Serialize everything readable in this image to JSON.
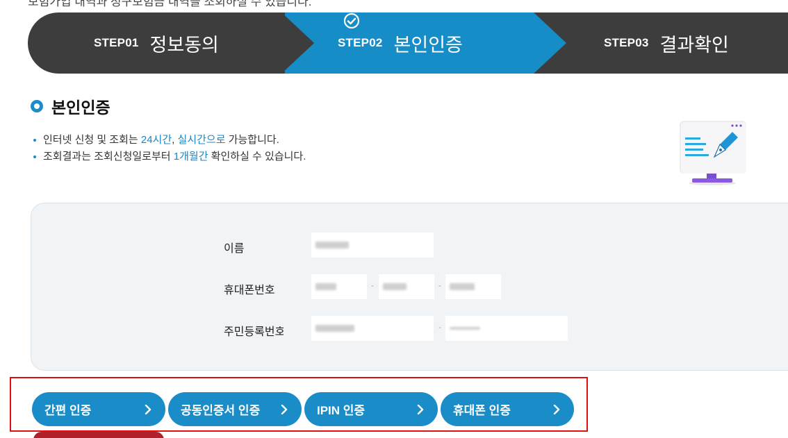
{
  "top_text": "보험가입 내역과 청구보험금 내역을 조회하실 수 있습니다.",
  "steps": [
    {
      "num": "STEP01",
      "name": "정보동의"
    },
    {
      "num": "STEP02",
      "name": "본인인증"
    },
    {
      "num": "STEP03",
      "name": "결과확인"
    }
  ],
  "colors": {
    "step_dark": "#3d3d3d",
    "step_active": "#168dc6",
    "accent": "#1a8cc8",
    "highlight_frame": "#e00f14"
  },
  "section": {
    "title": "본인인증"
  },
  "notes": [
    {
      "pre": "인터넷 신청 및 조회는 ",
      "hl1": "24시간",
      "mid": ", ",
      "hl2": "실시간으로",
      "post": " 가능합니다."
    },
    {
      "pre": "조회결과는 조회신청일로부터 ",
      "hl1": "1개월간",
      "post": " 확인하실 수 있습니다."
    }
  ],
  "form": {
    "name_label": "이름",
    "phone_label": "휴대폰번호",
    "rrn_label": "주민등록번호",
    "dash": "-"
  },
  "auth_buttons": [
    {
      "label": "간편 인증",
      "icon": "chevron-right-icon"
    },
    {
      "label": "공동인증서 인증",
      "icon": "chevron-right-icon"
    },
    {
      "label": "IPIN 인증",
      "icon": "chevron-right-icon"
    },
    {
      "label": "휴대폰 인증",
      "icon": "chevron-right-icon"
    }
  ]
}
